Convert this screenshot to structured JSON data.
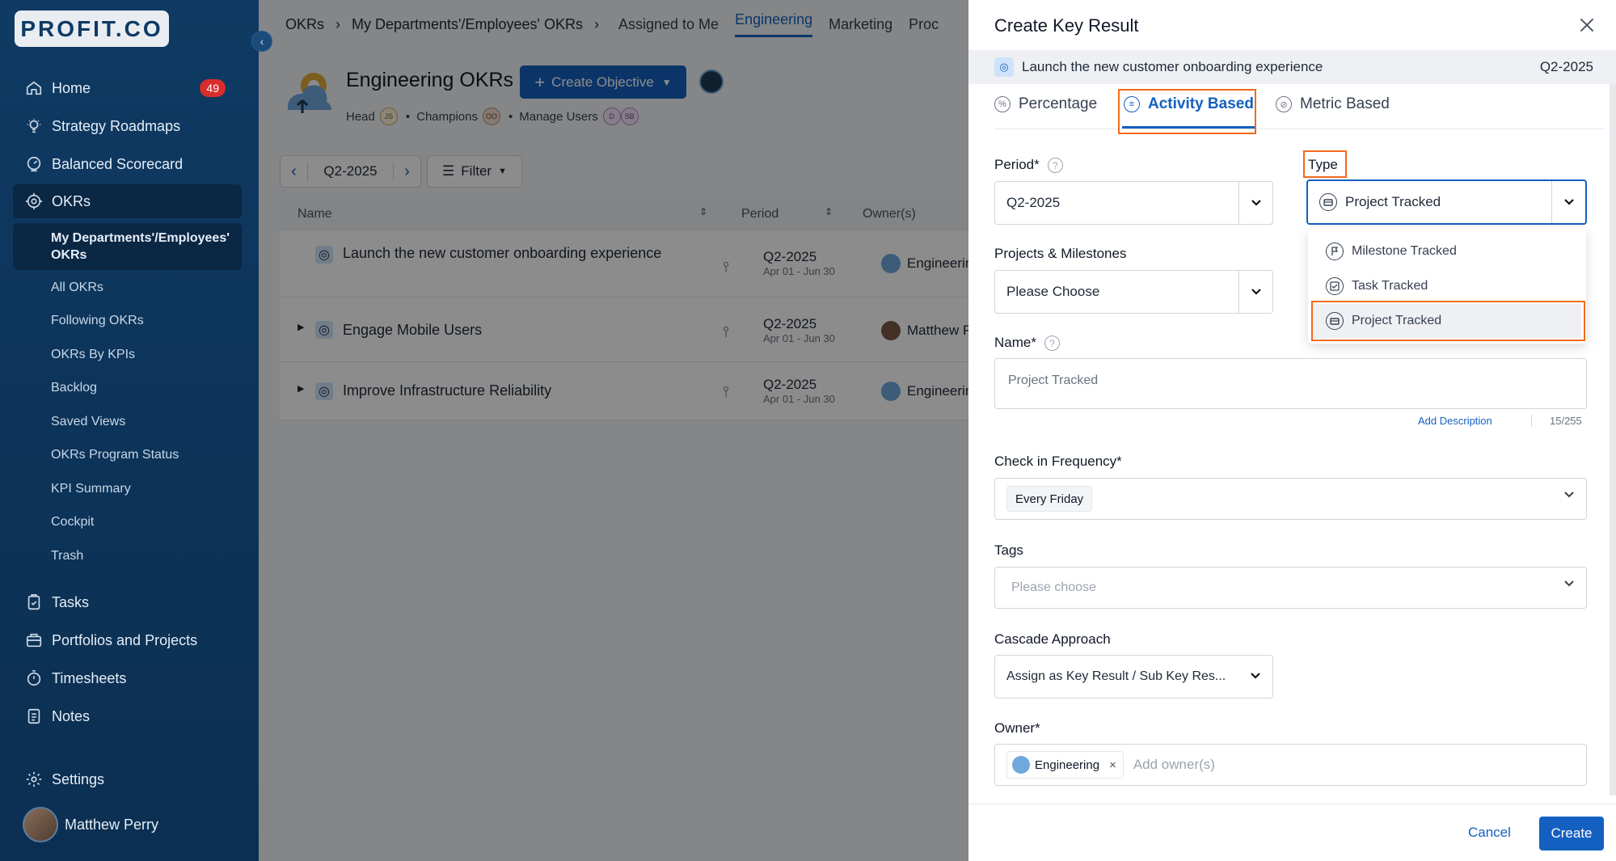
{
  "sidebar": {
    "logo": "PROFIT.CO",
    "items": [
      {
        "label": "Home",
        "badge": "49"
      },
      {
        "label": "Strategy Roadmaps"
      },
      {
        "label": "Balanced Scorecard"
      },
      {
        "label": "OKRs"
      },
      {
        "label": "Tasks"
      },
      {
        "label": "Portfolios and Projects"
      },
      {
        "label": "Timesheets"
      },
      {
        "label": "Notes"
      },
      {
        "label": "Settings"
      }
    ],
    "okr_sub": [
      "My Departments'/Employees' OKRs",
      "All OKRs",
      "Following OKRs",
      "OKRs By KPIs",
      "Backlog",
      "Saved Views",
      "OKRs Program Status",
      "KPI Summary",
      "Cockpit",
      "Trash"
    ],
    "user": "Matthew Perry"
  },
  "main": {
    "breadcrumb": [
      "OKRs",
      "My Departments'/Employees' OKRs"
    ],
    "tabs": [
      "Assigned to Me",
      "Engineering",
      "Marketing",
      "Proc"
    ],
    "active_tab": "Engineering",
    "title": "Engineering OKRs",
    "create_objective": "Create Objective",
    "meta": {
      "head": "Head",
      "head_initials": "JS",
      "champions": "Champions",
      "champ_initials": "OO",
      "manage": "Manage Users",
      "manage_i1": "D",
      "manage_i2": "SB"
    },
    "period": "Q2-2025",
    "filter": "Filter",
    "columns": [
      "Name",
      "Period",
      "Owner(s)"
    ],
    "rows": [
      {
        "name": "Launch the new customer onboarding experience",
        "period": "Q2-2025",
        "range": "Apr 01 - Jun 30",
        "owner": "Engineering"
      },
      {
        "name": "Engage Mobile Users",
        "period": "Q2-2025",
        "range": "Apr 01 - Jun 30",
        "owner": "Matthew Per"
      },
      {
        "name": "Improve Infrastructure Reliability",
        "period": "Q2-2025",
        "range": "Apr 01 - Jun 30",
        "owner": "Engineering"
      }
    ]
  },
  "drawer": {
    "title": "Create Key Result",
    "objective": "Launch the new customer onboarding experience",
    "objective_period": "Q2-2025",
    "tabs": [
      "Percentage",
      "Activity Based",
      "Metric Based"
    ],
    "active_tab": "Activity Based",
    "period_label": "Period*",
    "period_value": "Q2-2025",
    "type_label": "Type",
    "type_value": "Project Tracked",
    "type_options": [
      "Milestone Tracked",
      "Task Tracked",
      "Project Tracked"
    ],
    "projects_label": "Projects & Milestones",
    "projects_placeholder": "Please Choose",
    "name_label": "Name*",
    "name_value": "Project Tracked",
    "add_description": "Add Description",
    "char_count": "15/255",
    "checkin_label": "Check in Frequency*",
    "checkin_value": "Every Friday",
    "tags_label": "Tags",
    "tags_placeholder": "Please choose",
    "cascade_label": "Cascade Approach",
    "cascade_value": "Assign as Key Result / Sub Key Res...",
    "owner_label": "Owner*",
    "owner_chip": "Engineering",
    "owner_placeholder": "Add owner(s)",
    "cancel": "Cancel",
    "create": "Create"
  },
  "colors": {
    "accent": "#1460c0",
    "highlight": "#f06a1d",
    "sidebar": "#0f3a63"
  }
}
